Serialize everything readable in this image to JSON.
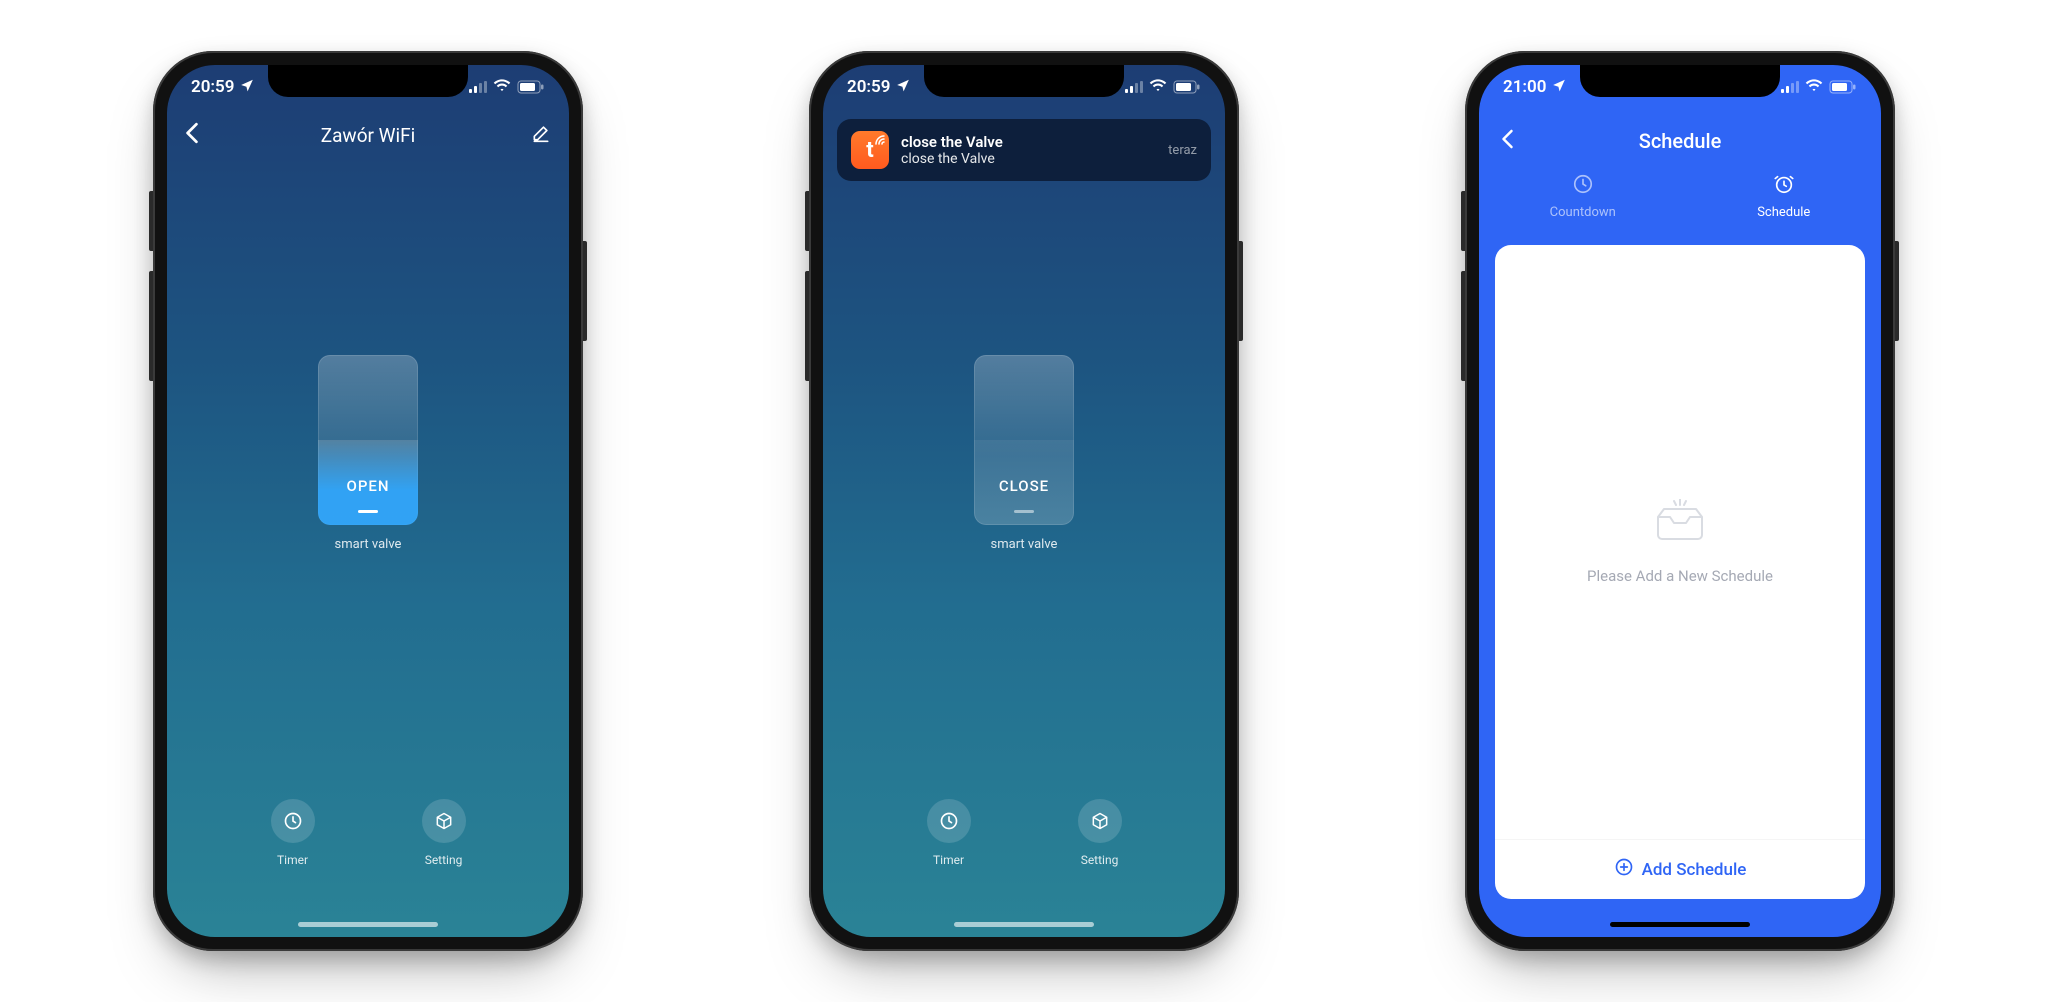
{
  "screen1": {
    "status": {
      "time": "20:59"
    },
    "nav": {
      "title": "Zawór WiFi"
    },
    "valve": {
      "state": "OPEN",
      "caption": "smart valve"
    },
    "actions": {
      "timer": "Timer",
      "setting": "Setting"
    }
  },
  "screen2": {
    "status": {
      "time": "20:59"
    },
    "notification": {
      "app_letter": "t",
      "title": "close the Valve",
      "body": "close the Valve",
      "time": "teraz"
    },
    "valve": {
      "state": "CLOSE",
      "caption": "smart valve"
    },
    "actions": {
      "timer": "Timer",
      "setting": "Setting"
    }
  },
  "screen3": {
    "status": {
      "time": "21:00"
    },
    "nav": {
      "title": "Schedule"
    },
    "tabs": {
      "countdown": "Countdown",
      "schedule": "Schedule"
    },
    "empty_text": "Please Add a New Schedule",
    "add_label": "Add Schedule"
  }
}
